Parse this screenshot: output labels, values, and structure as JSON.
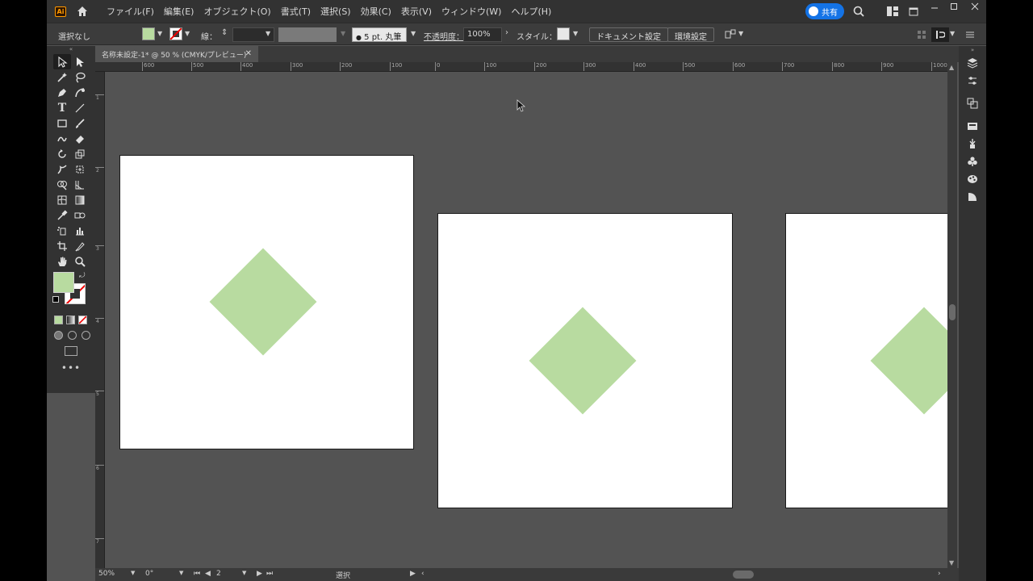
{
  "app": {
    "logo_text": "Ai",
    "menu": [
      "ファイル(F)",
      "編集(E)",
      "オブジェクト(O)",
      "書式(T)",
      "選択(S)",
      "効果(C)",
      "表示(V)",
      "ウィンドウ(W)",
      "ヘルプ(H)"
    ],
    "share_label": "共有"
  },
  "controlbar": {
    "selection_label": "選択なし",
    "stroke_label": "線：",
    "brush_label": "5 pt. 丸筆",
    "opacity_label": "不透明度：",
    "opacity_value": "100%",
    "style_label": "スタイル：",
    "document_setup_label": "ドキュメント設定",
    "preferences_label": "環境設定",
    "fill_color": "#b8dba0"
  },
  "document": {
    "tab_title": "名称未設定-1* @ 50 % (CMYK/プレビュー)"
  },
  "ruler": {
    "h_labels": [
      "600",
      "500",
      "400",
      "300",
      "200",
      "100",
      "0",
      "100",
      "200",
      "300",
      "400",
      "500",
      "600",
      "700",
      "800",
      "900",
      "1000"
    ],
    "v_labels": [
      "1",
      "2",
      "3",
      "4",
      "5",
      "6",
      "7"
    ]
  },
  "artboards": {
    "shape_color": "#b8dba0"
  },
  "status": {
    "zoom": "50%",
    "rotation": "0°",
    "artboard_number": "2",
    "tool_name": "選択"
  }
}
